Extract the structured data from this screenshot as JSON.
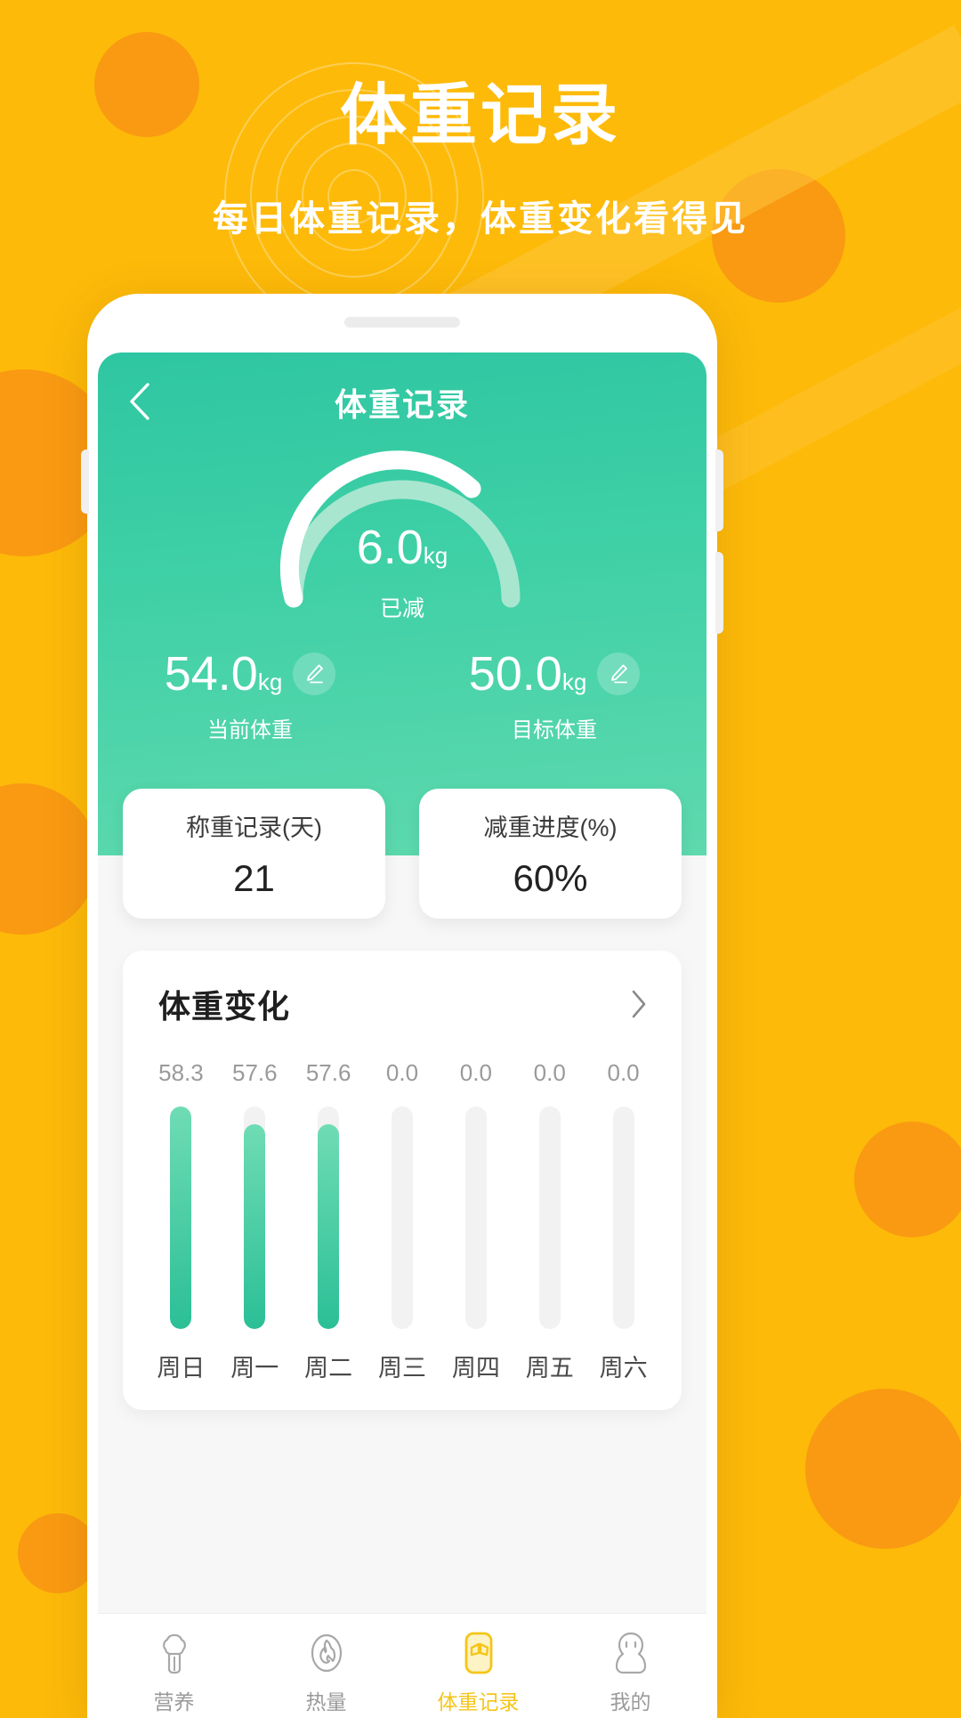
{
  "hero": {
    "title": "体重记录",
    "subtitle": "每日体重记录，体重变化看得见"
  },
  "colors": {
    "background": "#FDBA09",
    "blob": "#F99A12",
    "green_start": "#2EC6A2",
    "green_end": "#5FD9AE",
    "bar_fill": "#3FD0A6",
    "bar_track": "#F2F2F2",
    "accent_yellow": "#F5C518"
  },
  "app": {
    "nav": {
      "back_icon": "chevron-left-icon",
      "title": "体重记录"
    },
    "gauge": {
      "value": "6.0",
      "unit": "kg",
      "label": "已减",
      "progress_percent": 60
    },
    "weights": [
      {
        "value": "54.0",
        "unit": "kg",
        "label": "当前体重",
        "edit_icon": "pencil-edit-icon"
      },
      {
        "value": "50.0",
        "unit": "kg",
        "label": "目标体重",
        "edit_icon": "pencil-edit-icon"
      }
    ],
    "stats": [
      {
        "title": "称重记录(天)",
        "value": "21"
      },
      {
        "title": "减重进度(%)",
        "value": "60%"
      }
    ],
    "chart_card": {
      "title": "体重变化",
      "more_icon": "chevron-right-icon"
    },
    "tabs": [
      {
        "label": "营养",
        "icon": "broccoli-icon",
        "active": false
      },
      {
        "label": "热量",
        "icon": "flame-icon",
        "active": false
      },
      {
        "label": "体重记录",
        "icon": "scale-icon",
        "active": true
      },
      {
        "label": "我的",
        "icon": "person-icon",
        "active": false
      }
    ]
  },
  "chart_data": {
    "type": "bar",
    "title": "体重变化",
    "categories": [
      "周日",
      "周一",
      "周二",
      "周三",
      "周四",
      "周五",
      "周六"
    ],
    "values": [
      58.3,
      57.6,
      57.6,
      0.0,
      0.0,
      0.0,
      0.0
    ],
    "labels": [
      "58.3",
      "57.6",
      "57.6",
      "0.0",
      "0.0",
      "0.0",
      "0.0"
    ],
    "bar_heights_pct": [
      100,
      92,
      92,
      0,
      0,
      0,
      0
    ],
    "xlabel": "",
    "ylabel": "",
    "grid": false,
    "legend": false,
    "track_shown": true
  }
}
